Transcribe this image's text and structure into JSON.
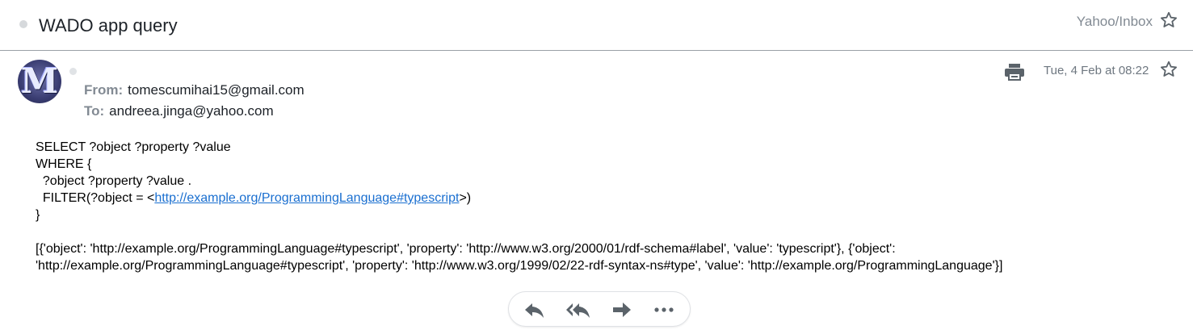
{
  "email": {
    "subject": "WADO app query",
    "folder": "Yahoo/Inbox",
    "avatar_letter": "M",
    "from_label": "From:",
    "from_address": "tomescumihai15@gmail.com",
    "to_label": "To:",
    "to_address": "andreea.jinga@yahoo.com",
    "date": "Tue, 4 Feb at 08:22",
    "body": {
      "line1": "SELECT ?object ?property ?value",
      "line2": "WHERE {",
      "line3": "  ?object ?property ?value .",
      "line4_prefix": "  FILTER(?object = <",
      "line4_link": "http://example.org/ProgrammingLanguage#typescript",
      "line4_suffix": ">)",
      "line5": "}",
      "result": "[{'object': 'http://example.org/ProgrammingLanguage#typescript', 'property': 'http://www.w3.org/2000/01/rdf-schema#label', 'value': 'typescript'}, {'object': 'http://example.org/ProgrammingLanguage#typescript', 'property': 'http://www.w3.org/1999/02/22-rdf-syntax-ns#type', 'value': 'http://example.org/ProgrammingLanguage'}]"
    }
  },
  "icons": {
    "unread": "unread-dot-icon",
    "star": "star-icon",
    "print": "print-icon",
    "reply": "reply-icon",
    "reply_all": "reply-all-icon",
    "forward": "forward-icon",
    "more": "more-icon"
  },
  "colors": {
    "link": "#1a6fd0",
    "icon": "#5b636a",
    "muted": "#828a93"
  }
}
